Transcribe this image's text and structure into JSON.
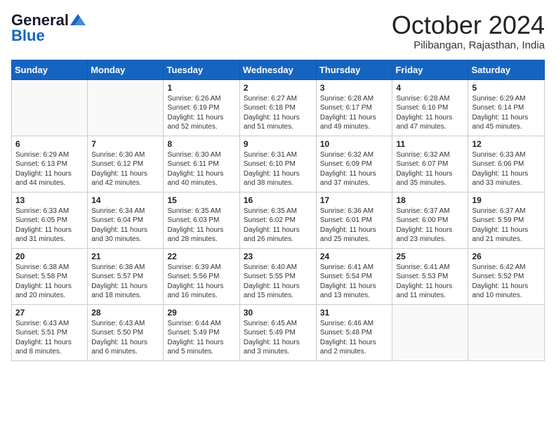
{
  "logo": {
    "line1": "General",
    "line2": "Blue"
  },
  "title": "October 2024",
  "location": "Pilibangan, Rajasthan, India",
  "headers": [
    "Sunday",
    "Monday",
    "Tuesday",
    "Wednesday",
    "Thursday",
    "Friday",
    "Saturday"
  ],
  "weeks": [
    [
      {
        "day": "",
        "info": ""
      },
      {
        "day": "",
        "info": ""
      },
      {
        "day": "1",
        "info": "Sunrise: 6:26 AM\nSunset: 6:19 PM\nDaylight: 11 hours\nand 52 minutes."
      },
      {
        "day": "2",
        "info": "Sunrise: 6:27 AM\nSunset: 6:18 PM\nDaylight: 11 hours\nand 51 minutes."
      },
      {
        "day": "3",
        "info": "Sunrise: 6:28 AM\nSunset: 6:17 PM\nDaylight: 11 hours\nand 49 minutes."
      },
      {
        "day": "4",
        "info": "Sunrise: 6:28 AM\nSunset: 6:16 PM\nDaylight: 11 hours\nand 47 minutes."
      },
      {
        "day": "5",
        "info": "Sunrise: 6:29 AM\nSunset: 6:14 PM\nDaylight: 11 hours\nand 45 minutes."
      }
    ],
    [
      {
        "day": "6",
        "info": "Sunrise: 6:29 AM\nSunset: 6:13 PM\nDaylight: 11 hours\nand 44 minutes."
      },
      {
        "day": "7",
        "info": "Sunrise: 6:30 AM\nSunset: 6:12 PM\nDaylight: 11 hours\nand 42 minutes."
      },
      {
        "day": "8",
        "info": "Sunrise: 6:30 AM\nSunset: 6:11 PM\nDaylight: 11 hours\nand 40 minutes."
      },
      {
        "day": "9",
        "info": "Sunrise: 6:31 AM\nSunset: 6:10 PM\nDaylight: 11 hours\nand 38 minutes."
      },
      {
        "day": "10",
        "info": "Sunrise: 6:32 AM\nSunset: 6:09 PM\nDaylight: 11 hours\nand 37 minutes."
      },
      {
        "day": "11",
        "info": "Sunrise: 6:32 AM\nSunset: 6:07 PM\nDaylight: 11 hours\nand 35 minutes."
      },
      {
        "day": "12",
        "info": "Sunrise: 6:33 AM\nSunset: 6:06 PM\nDaylight: 11 hours\nand 33 minutes."
      }
    ],
    [
      {
        "day": "13",
        "info": "Sunrise: 6:33 AM\nSunset: 6:05 PM\nDaylight: 11 hours\nand 31 minutes."
      },
      {
        "day": "14",
        "info": "Sunrise: 6:34 AM\nSunset: 6:04 PM\nDaylight: 11 hours\nand 30 minutes."
      },
      {
        "day": "15",
        "info": "Sunrise: 6:35 AM\nSunset: 6:03 PM\nDaylight: 11 hours\nand 28 minutes."
      },
      {
        "day": "16",
        "info": "Sunrise: 6:35 AM\nSunset: 6:02 PM\nDaylight: 11 hours\nand 26 minutes."
      },
      {
        "day": "17",
        "info": "Sunrise: 6:36 AM\nSunset: 6:01 PM\nDaylight: 11 hours\nand 25 minutes."
      },
      {
        "day": "18",
        "info": "Sunrise: 6:37 AM\nSunset: 6:00 PM\nDaylight: 11 hours\nand 23 minutes."
      },
      {
        "day": "19",
        "info": "Sunrise: 6:37 AM\nSunset: 5:59 PM\nDaylight: 11 hours\nand 21 minutes."
      }
    ],
    [
      {
        "day": "20",
        "info": "Sunrise: 6:38 AM\nSunset: 5:58 PM\nDaylight: 11 hours\nand 20 minutes."
      },
      {
        "day": "21",
        "info": "Sunrise: 6:38 AM\nSunset: 5:57 PM\nDaylight: 11 hours\nand 18 minutes."
      },
      {
        "day": "22",
        "info": "Sunrise: 6:39 AM\nSunset: 5:56 PM\nDaylight: 11 hours\nand 16 minutes."
      },
      {
        "day": "23",
        "info": "Sunrise: 6:40 AM\nSunset: 5:55 PM\nDaylight: 11 hours\nand 15 minutes."
      },
      {
        "day": "24",
        "info": "Sunrise: 6:41 AM\nSunset: 5:54 PM\nDaylight: 11 hours\nand 13 minutes."
      },
      {
        "day": "25",
        "info": "Sunrise: 6:41 AM\nSunset: 5:53 PM\nDaylight: 11 hours\nand 11 minutes."
      },
      {
        "day": "26",
        "info": "Sunrise: 6:42 AM\nSunset: 5:52 PM\nDaylight: 11 hours\nand 10 minutes."
      }
    ],
    [
      {
        "day": "27",
        "info": "Sunrise: 6:43 AM\nSunset: 5:51 PM\nDaylight: 11 hours\nand 8 minutes."
      },
      {
        "day": "28",
        "info": "Sunrise: 6:43 AM\nSunset: 5:50 PM\nDaylight: 11 hours\nand 6 minutes."
      },
      {
        "day": "29",
        "info": "Sunrise: 6:44 AM\nSunset: 5:49 PM\nDaylight: 11 hours\nand 5 minutes."
      },
      {
        "day": "30",
        "info": "Sunrise: 6:45 AM\nSunset: 5:49 PM\nDaylight: 11 hours\nand 3 minutes."
      },
      {
        "day": "31",
        "info": "Sunrise: 6:46 AM\nSunset: 5:48 PM\nDaylight: 11 hours\nand 2 minutes."
      },
      {
        "day": "",
        "info": ""
      },
      {
        "day": "",
        "info": ""
      }
    ]
  ]
}
